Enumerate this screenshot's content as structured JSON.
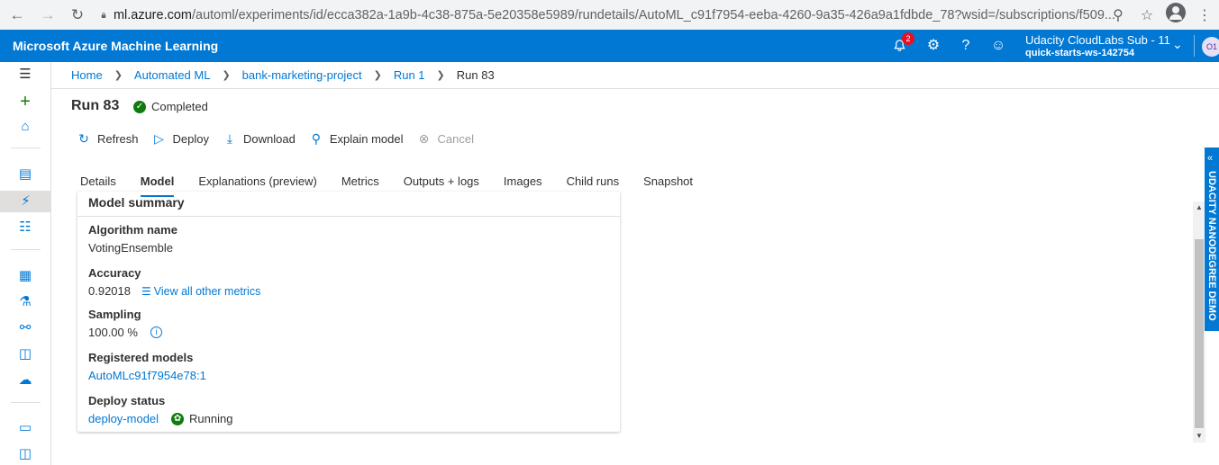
{
  "browser": {
    "url_host": "ml.azure.com",
    "url_path": "/automl/experiments/id/ecca382a-1a9b-4c38-875a-5e20358e5989/rundetails/AutoML_c91f7954-eeba-4260-9a35-426a9a1fdbde_78?wsid=/subscriptions/f509..."
  },
  "topbar": {
    "brand": "Microsoft Azure Machine Learning",
    "notification_count": "2",
    "account_subscription": "Udacity CloudLabs Sub - 11",
    "account_workspace": "quick-starts-ws-142754",
    "avatar_initials": "O1",
    "accent": "#0078d4"
  },
  "breadcrumb": {
    "items": [
      "Home",
      "Automated ML",
      "bank-marketing-project",
      "Run 1"
    ],
    "current": "Run 83"
  },
  "run": {
    "title": "Run 83",
    "status": "Completed",
    "status_color": "#107c10"
  },
  "toolbar": {
    "refresh": "Refresh",
    "deploy": "Deploy",
    "download": "Download",
    "explain": "Explain model",
    "cancel": "Cancel"
  },
  "tabs": [
    "Details",
    "Model",
    "Explanations (preview)",
    "Metrics",
    "Outputs + logs",
    "Images",
    "Child runs",
    "Snapshot"
  ],
  "active_tab": "Model",
  "model_summary": {
    "heading": "Model summary",
    "algorithm_label": "Algorithm name",
    "algorithm_value": "VotingEnsemble",
    "accuracy_label": "Accuracy",
    "accuracy_value": "0.92018",
    "metrics_link": "View all other metrics",
    "sampling_label": "Sampling",
    "sampling_value": "100.00 %",
    "registered_label": "Registered models",
    "registered_value": "AutoMLc91f7954e78:1",
    "deploy_label": "Deploy status",
    "deploy_value": "deploy-model",
    "deploy_state": "Running"
  },
  "side_tab": "UDACITY NANODEGREE DEMO"
}
